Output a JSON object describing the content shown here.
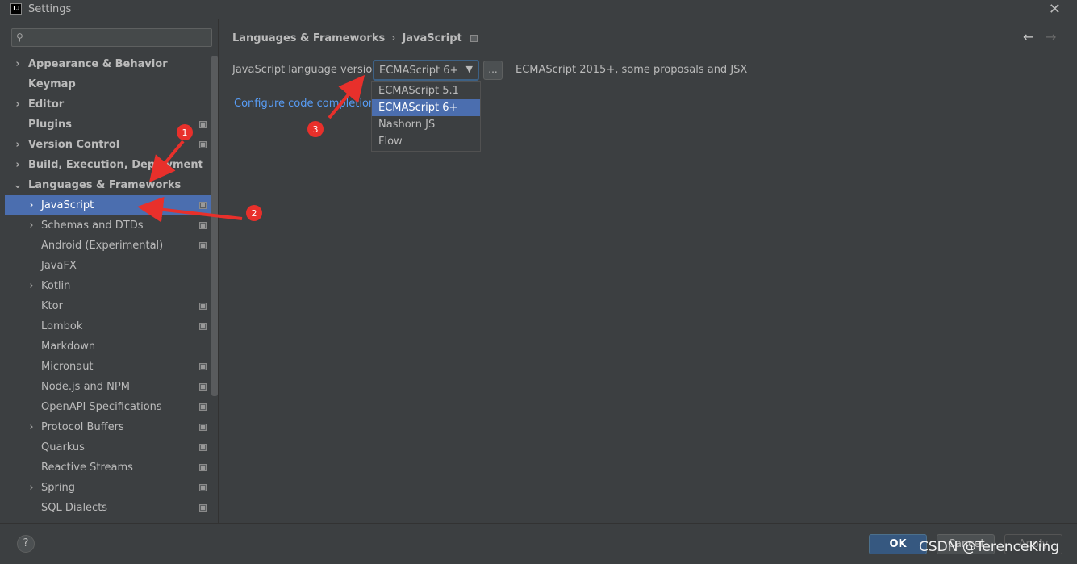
{
  "window": {
    "title": "Settings",
    "app_icon_text": "IJ"
  },
  "search": {
    "placeholder": ""
  },
  "sidebar": {
    "items": [
      {
        "label": "Appearance & Behavior",
        "chevron": "›",
        "bold": true
      },
      {
        "label": "Keymap",
        "chevron": "",
        "bold": true
      },
      {
        "label": "Editor",
        "chevron": "›",
        "bold": true
      },
      {
        "label": "Plugins",
        "chevron": "",
        "bold": true
      },
      {
        "label": "Version Control",
        "chevron": "›",
        "bold": true
      },
      {
        "label": "Build, Execution, Deployment",
        "chevron": "›",
        "bold": true
      },
      {
        "label": "Languages & Frameworks",
        "chevron": "⌄",
        "bold": true
      },
      {
        "label": "JavaScript",
        "chevron": "›",
        "bold": false
      },
      {
        "label": "Schemas and DTDs",
        "chevron": "›",
        "bold": false
      },
      {
        "label": "Android (Experimental)",
        "chevron": "",
        "bold": false
      },
      {
        "label": "JavaFX",
        "chevron": "",
        "bold": false
      },
      {
        "label": "Kotlin",
        "chevron": "›",
        "bold": false
      },
      {
        "label": "Ktor",
        "chevron": "",
        "bold": false
      },
      {
        "label": "Lombok",
        "chevron": "",
        "bold": false
      },
      {
        "label": "Markdown",
        "chevron": "",
        "bold": false
      },
      {
        "label": "Micronaut",
        "chevron": "",
        "bold": false
      },
      {
        "label": "Node.js and NPM",
        "chevron": "",
        "bold": false
      },
      {
        "label": "OpenAPI Specifications",
        "chevron": "",
        "bold": false
      },
      {
        "label": "Protocol Buffers",
        "chevron": "›",
        "bold": false
      },
      {
        "label": "Quarkus",
        "chevron": "",
        "bold": false
      },
      {
        "label": "Reactive Streams",
        "chevron": "",
        "bold": false
      },
      {
        "label": "Spring",
        "chevron": "›",
        "bold": false
      },
      {
        "label": "SQL Dialects",
        "chevron": "",
        "bold": false
      }
    ]
  },
  "breadcrumb": {
    "parent": "Languages & Frameworks",
    "separator": "›",
    "current": "JavaScript"
  },
  "nav": {
    "back": "←",
    "forward": "→"
  },
  "js_settings": {
    "language_version_label": "JavaScript language version",
    "selected_version": "ECMAScript 6+",
    "dots_label": "...",
    "description": "ECMAScript 2015+, some proposals and JSX",
    "config_link": "Configure code completion s",
    "options": [
      "ECMAScript 5.1",
      "ECMAScript 6+",
      "Nashorn JS",
      "Flow"
    ]
  },
  "footer": {
    "help": "?",
    "ok": "OK",
    "cancel": "Cancel",
    "apply": "Apply"
  },
  "annotations": {
    "badge_1": "1",
    "badge_2": "2",
    "badge_3": "3"
  },
  "watermark": "CSDN @TerenceKing",
  "colors": {
    "selection": "#4b6eaf",
    "link": "#589df6",
    "annotation": "#e8302b",
    "background": "#3c3f41"
  }
}
